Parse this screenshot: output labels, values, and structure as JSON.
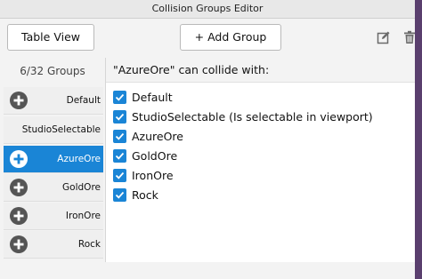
{
  "window": {
    "title": "Collision Groups Editor"
  },
  "toolbar": {
    "table_view_label": "Table View",
    "add_group_label": "+ Add Group",
    "edit_icon": "edit-icon",
    "trash_icon": "trash-icon"
  },
  "sidebar": {
    "count_label": "6/32 Groups",
    "groups": [
      {
        "label": "Default",
        "has_add": true,
        "selected": false
      },
      {
        "label": "StudioSelectable",
        "has_add": false,
        "selected": false
      },
      {
        "label": "AzureOre",
        "has_add": true,
        "selected": true
      },
      {
        "label": "GoldOre",
        "has_add": true,
        "selected": false
      },
      {
        "label": "IronOre",
        "has_add": true,
        "selected": false
      },
      {
        "label": "Rock",
        "has_add": true,
        "selected": false
      }
    ]
  },
  "main": {
    "header": "\"AzureOre\" can collide with:",
    "items": [
      {
        "label": "Default",
        "checked": true
      },
      {
        "label": "StudioSelectable (Is selectable in viewport)",
        "checked": true
      },
      {
        "label": "AzureOre",
        "checked": true
      },
      {
        "label": "GoldOre",
        "checked": true
      },
      {
        "label": "IronOre",
        "checked": true
      },
      {
        "label": "Rock",
        "checked": true
      }
    ]
  },
  "colors": {
    "accent": "#1a85d6",
    "background": "#5a3f6e"
  }
}
